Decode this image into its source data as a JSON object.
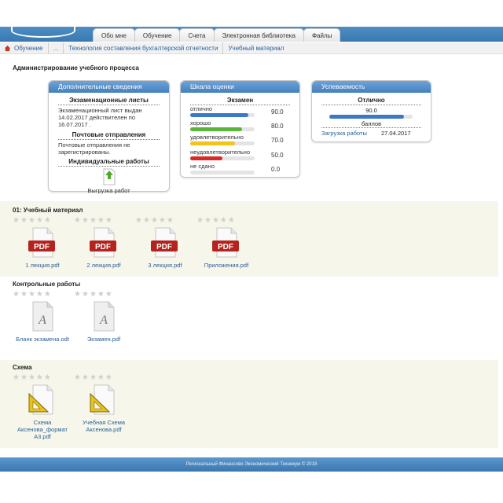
{
  "nav": {
    "tabs": [
      "Обо мне",
      "Обучение",
      "Счета",
      "Электронная библиотека",
      "Файлы"
    ]
  },
  "breadcrumb": [
    "Обучение",
    "...",
    "Технология составления бухгалтерской отчетности",
    "Учебный материал"
  ],
  "page_title": "Администрирование учебного процесса",
  "extra_info": {
    "title": "Дополнительные сведения",
    "exam_sheets_heading": "Экзаменационные листы",
    "exam_sheets_text": "Экзаменационный лист выдан 14.02.2017 действителен по 16.07.2017 .",
    "mail_heading": "Почтовые отправления",
    "mail_text": "Почтовые отправления не зарегистрированы.",
    "individual_heading": "Индивидуальные работы",
    "upload_label": "Выгрузка работ"
  },
  "grade_scale": {
    "title": "Шкала оценки",
    "column": "Экзамен",
    "rows": [
      {
        "label": "отлично",
        "value": "90.0",
        "color": "#3a78c9",
        "fill": 0.9
      },
      {
        "label": "хорошо",
        "value": "80.0",
        "color": "#5ab53a",
        "fill": 0.8
      },
      {
        "label": "удовлетворительно",
        "value": "70.0",
        "color": "#f0c419",
        "fill": 0.7
      },
      {
        "label": "неудовлетворительно",
        "value": "50.0",
        "color": "#d92a2a",
        "fill": 0.5
      },
      {
        "label": "не сдано",
        "value": "0.0",
        "color": "#999999",
        "fill": 0.0
      }
    ]
  },
  "progress": {
    "title": "Успеваемость",
    "grade": "Отлично",
    "score": "90.0",
    "fill": 0.9,
    "score_unit": "баллов",
    "upload_link": "Загрузка работы",
    "date": "27.04.2017"
  },
  "sections": [
    {
      "title": "01: Учебный материал",
      "files": [
        {
          "name": "1 лекция.pdf",
          "icon": "pdf-icon"
        },
        {
          "name": "2 лекция.pdf",
          "icon": "pdf-icon"
        },
        {
          "name": "3 лекция.pdf",
          "icon": "pdf-icon"
        },
        {
          "name": "Приложения.pdf",
          "icon": "pdf-icon"
        }
      ]
    },
    {
      "title": "Контрольные работы",
      "files": [
        {
          "name": "Бланк экзамена.odt",
          "icon": "document-icon"
        },
        {
          "name": "Экзамен.pdf",
          "icon": "document-icon"
        }
      ]
    },
    {
      "title": "Схема",
      "files": [
        {
          "name": "Схема Аксенова_формат А3.pdf",
          "icon": "ruler-triangle-icon"
        },
        {
          "name": "Учебная Схема Аксенова.pdf",
          "icon": "ruler-triangle-icon"
        }
      ]
    }
  ],
  "footer": "Региональный Финансово-Экономический Техникум © 2018"
}
